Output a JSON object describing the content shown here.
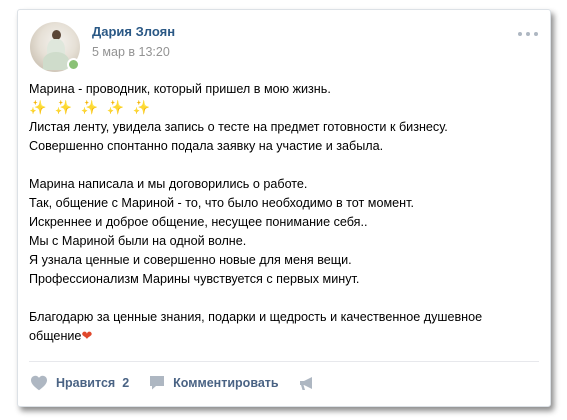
{
  "post": {
    "author": "Дария Злоян",
    "date": "5 мар в 13:20",
    "online": true,
    "lines": [
      "Марина - проводник, который пришел в мою жизнь.",
      "✨ ✨ ✨ ✨ ✨",
      "Листая ленту, увидела запись о тесте на предмет готовности к бизнесу.",
      "Совершенно спонтанно подала заявку на участие и забыла.",
      "",
      "Марина написала и мы договорились о работе.",
      "Так, общение с Мариной - то, что было необходимо в тот момент.",
      "Искреннее и доброе общение, несущее понимание себя..",
      "Мы с Мариной были на одной волне.",
      "Я узнала ценные и совершенно новые для меня вещи.",
      "Профессионализм Марины чувствуется с первых минут.",
      "",
      "Благодарю за ценные знания, подарки и щедрость и качественное душевное",
      "общение"
    ],
    "last_line_emoji": "❤"
  },
  "actions": {
    "like_label": "Нравится",
    "like_count": "2",
    "comment_label": "Комментировать"
  },
  "icons": {
    "more": "more-horizontal-icon",
    "like": "heart-icon",
    "comment": "comment-icon",
    "share": "megaphone-icon"
  },
  "colors": {
    "author_link": "#2a5885",
    "date": "#939393",
    "action_text": "#4a6384",
    "icon": "#aeb7c2",
    "online": "#8ac176"
  }
}
